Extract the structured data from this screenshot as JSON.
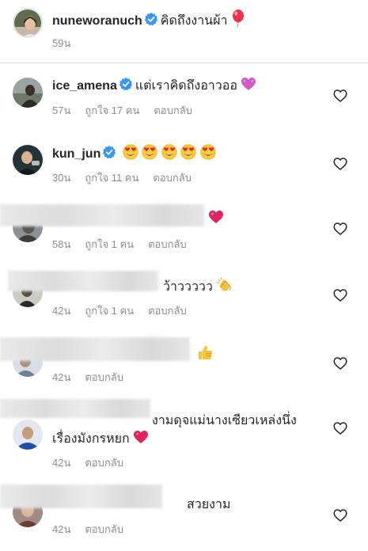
{
  "caption": {
    "username": "nuneworanuch",
    "text": "คิดถึงงานผ้า",
    "time": "59น"
  },
  "comments": [
    {
      "username": "ice_amena",
      "text": "แต่เราคิดถึงอาวออ",
      "time": "57น",
      "likes": "ถูกใจ 17 คน",
      "reply": "ตอบกลับ"
    },
    {
      "username": "kun_jun",
      "text": "",
      "time": "30น",
      "likes": "ถูกใจ 11 คน",
      "reply": "ตอบกลับ"
    },
    {
      "username": "",
      "text": "",
      "time": "58น",
      "likes": "ถูกใจ 1 คน",
      "reply": "ตอบกลับ"
    },
    {
      "username": "",
      "text": "ว้าววววว",
      "time": "42น",
      "likes": "ถูกใจ 1 คน",
      "reply": "ตอบกลับ"
    },
    {
      "username": "",
      "text": "",
      "time": "42น",
      "reply": "ตอบกลับ"
    },
    {
      "username": "",
      "text": "งามดุจแม่นางเซียวเหล่งนึ่ง",
      "text2": "เรื่องมังกรหยก",
      "time": "42น",
      "reply": "ตอบกลับ"
    },
    {
      "username": "",
      "text": "สวยงาม",
      "time": "42น",
      "reply": "ตอบกลับ"
    }
  ],
  "icons": {
    "verified": "verified-badge-icon",
    "like": "heart-outline-icon",
    "balloon": "red-balloon-emoji",
    "purple_heart": "purple-heart-emoji",
    "heart_eyes": "heart-eyes-emoji",
    "red_heart": "red-heart-emoji",
    "clap": "clapping-hands-emoji",
    "thumbs_up": "thumbs-up-emoji"
  },
  "colors": {
    "verified_blue": "#3897f0",
    "meta_gray": "#8e8e8e",
    "red_heart": "#e0245e"
  }
}
